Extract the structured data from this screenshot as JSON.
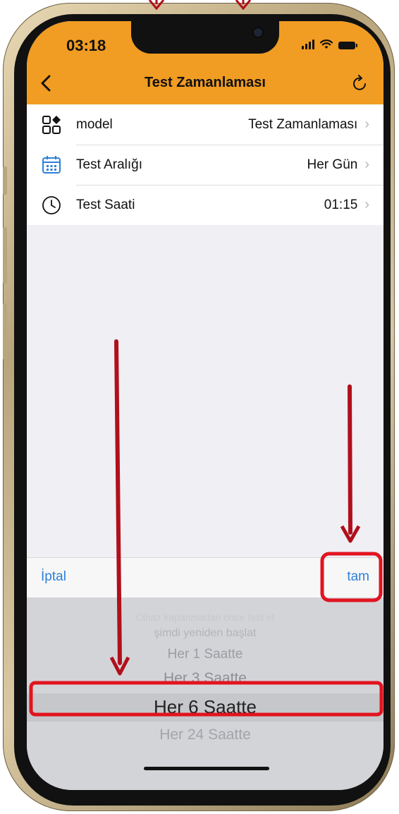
{
  "status_bar": {
    "time": "03:18"
  },
  "nav": {
    "title": "Test Zamanlaması"
  },
  "settings": [
    {
      "icon": "shapes-icon",
      "label": "model",
      "value": "Test Zamanlaması"
    },
    {
      "icon": "calendar-icon",
      "label": "Test Aralığı",
      "value": "Her Gün"
    },
    {
      "icon": "clock-icon",
      "label": "Test Saati",
      "value": "01:15"
    }
  ],
  "chevron": "›",
  "picker": {
    "cancel_label": "İptal",
    "done_label": "tam",
    "options": [
      "Cihaz kapanmadan önce test et",
      "şimdi yeniden başlat",
      "Her 1 Saatte",
      "Her 3 Saatte",
      "Her 6 Saatte",
      "Her 24 Saatte"
    ],
    "selected_index": 4
  },
  "colors": {
    "accent": "#f19c22",
    "link": "#2e7fd8",
    "annotation": "#b0101b"
  }
}
